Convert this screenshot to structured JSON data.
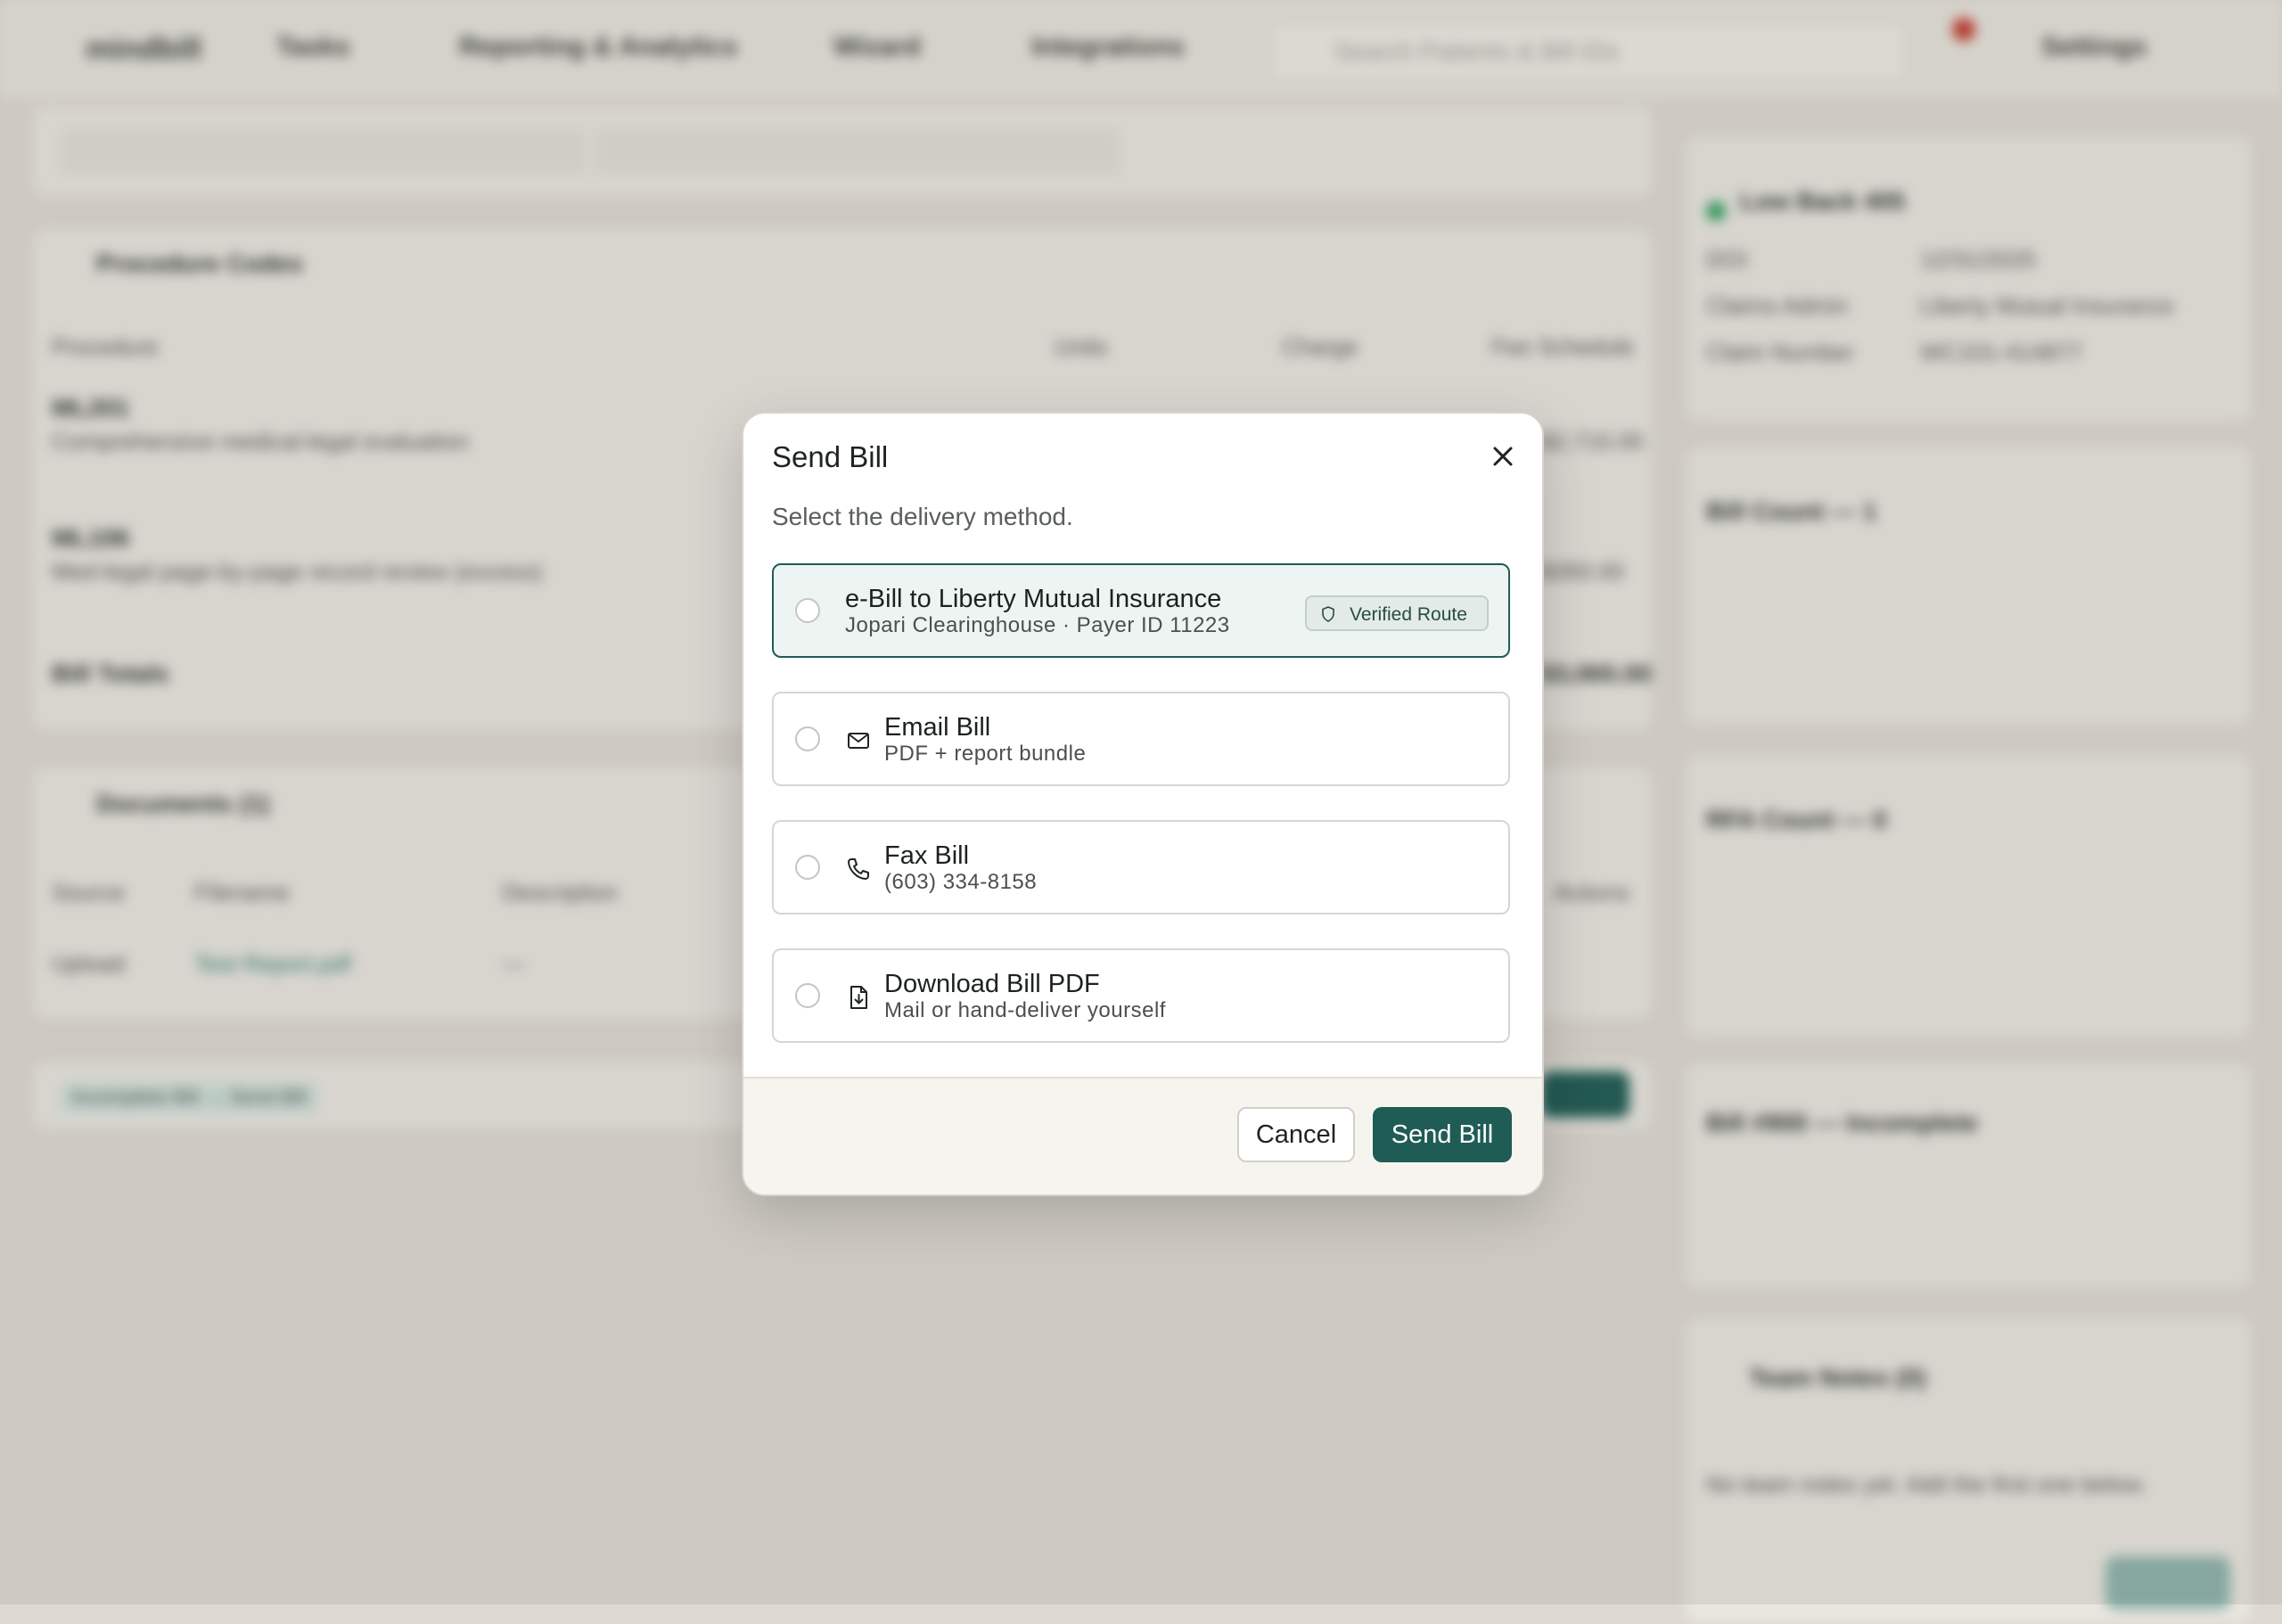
{
  "background": {
    "app_name": "mindbill",
    "nav": [
      "Tasks",
      "Reporting & Analytics",
      "Wizard",
      "Integrations",
      "Settings"
    ],
    "search_placeholder": "Search Patients & Bill IDs",
    "procedure_header": "Procedure Codes",
    "procedure_columns": [
      "Procedure",
      "Units",
      "Charge",
      "Fee Schedule"
    ],
    "procedures": [
      {
        "code": "ML201",
        "desc": "Comprehensive medical-legal evaluation",
        "amount": "$2,715.00"
      },
      {
        "code": "ML106",
        "desc": "Med-legal page-by-page record review (excess)",
        "amount": "$350.00"
      }
    ],
    "bill_totals": "Bill Totals",
    "bill_totals_amount": "$3,065.00",
    "documents_header": "Documents (1)",
    "documents_columns": [
      "Source",
      "Filename",
      "Description",
      "Actions"
    ],
    "document_row": {
      "source": "Upload",
      "filename": "Test Report.pdf",
      "description": "—"
    },
    "footer_status": "Incomplete Bill → Send Bill",
    "side_patient": "Low Back 405",
    "side_rows": [
      {
        "label": "DOI",
        "value": "12/31/2025"
      },
      {
        "label": "Claims Admin",
        "value": "Liberty Mutual Insurance"
      },
      {
        "label": "Claim Number",
        "value": "WC101-414877"
      }
    ],
    "bill_count": "Bill Count — 1",
    "rfa_count": "RFA Count — 0",
    "bill_status": "Bill #900 — Incomplete",
    "team_notes": "Team Notes (0)",
    "team_notes_empty": "No team notes yet. Add the first one below."
  },
  "modal": {
    "title": "Send Bill",
    "subtitle": "Select the delivery method.",
    "options": [
      {
        "title": "e-Bill to Liberty Mutual Insurance",
        "subtitle": "Jopari Clearinghouse · Payer ID 11223",
        "badge": "Verified Route",
        "icon": "shield-icon"
      },
      {
        "title": "Email Bill",
        "subtitle": "PDF + report bundle",
        "icon": "mail-icon"
      },
      {
        "title": "Fax Bill",
        "subtitle": "(603) 334-8158",
        "icon": "phone-icon"
      },
      {
        "title": "Download Bill PDF",
        "subtitle": "Mail or hand-deliver yourself",
        "icon": "file-download-icon"
      }
    ],
    "cancel_label": "Cancel",
    "send_label": "Send Bill"
  },
  "colors": {
    "accent": "#1f5c55",
    "selected_bg": "#eef4f2",
    "backdrop": "#dedad3"
  }
}
